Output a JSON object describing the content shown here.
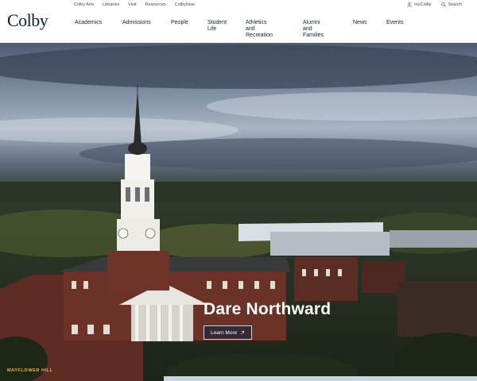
{
  "brand": {
    "logo_text": "Colby"
  },
  "utility_nav": {
    "left": [
      "Colby Arts",
      "Libraries",
      "Visit",
      "Resources",
      "ColbyNow"
    ],
    "mycolby_label": "myColby",
    "search_label": "Search"
  },
  "main_nav": {
    "items": [
      {
        "label": "Academics"
      },
      {
        "label": "Admissions"
      },
      {
        "label": "People"
      },
      {
        "label": "Student\nLife"
      },
      {
        "label": "Athletics and\nRecreation"
      },
      {
        "label": "Alumni and\nFamilies"
      },
      {
        "label": "News"
      },
      {
        "label": "Events"
      }
    ]
  },
  "hero": {
    "title": "Dare Northward",
    "button_label": "Learn More",
    "caption": "MAYFLOWER HILL"
  },
  "colors": {
    "navy": "#0a2240",
    "accent_gold": "#e8b64a",
    "white": "#ffffff"
  }
}
